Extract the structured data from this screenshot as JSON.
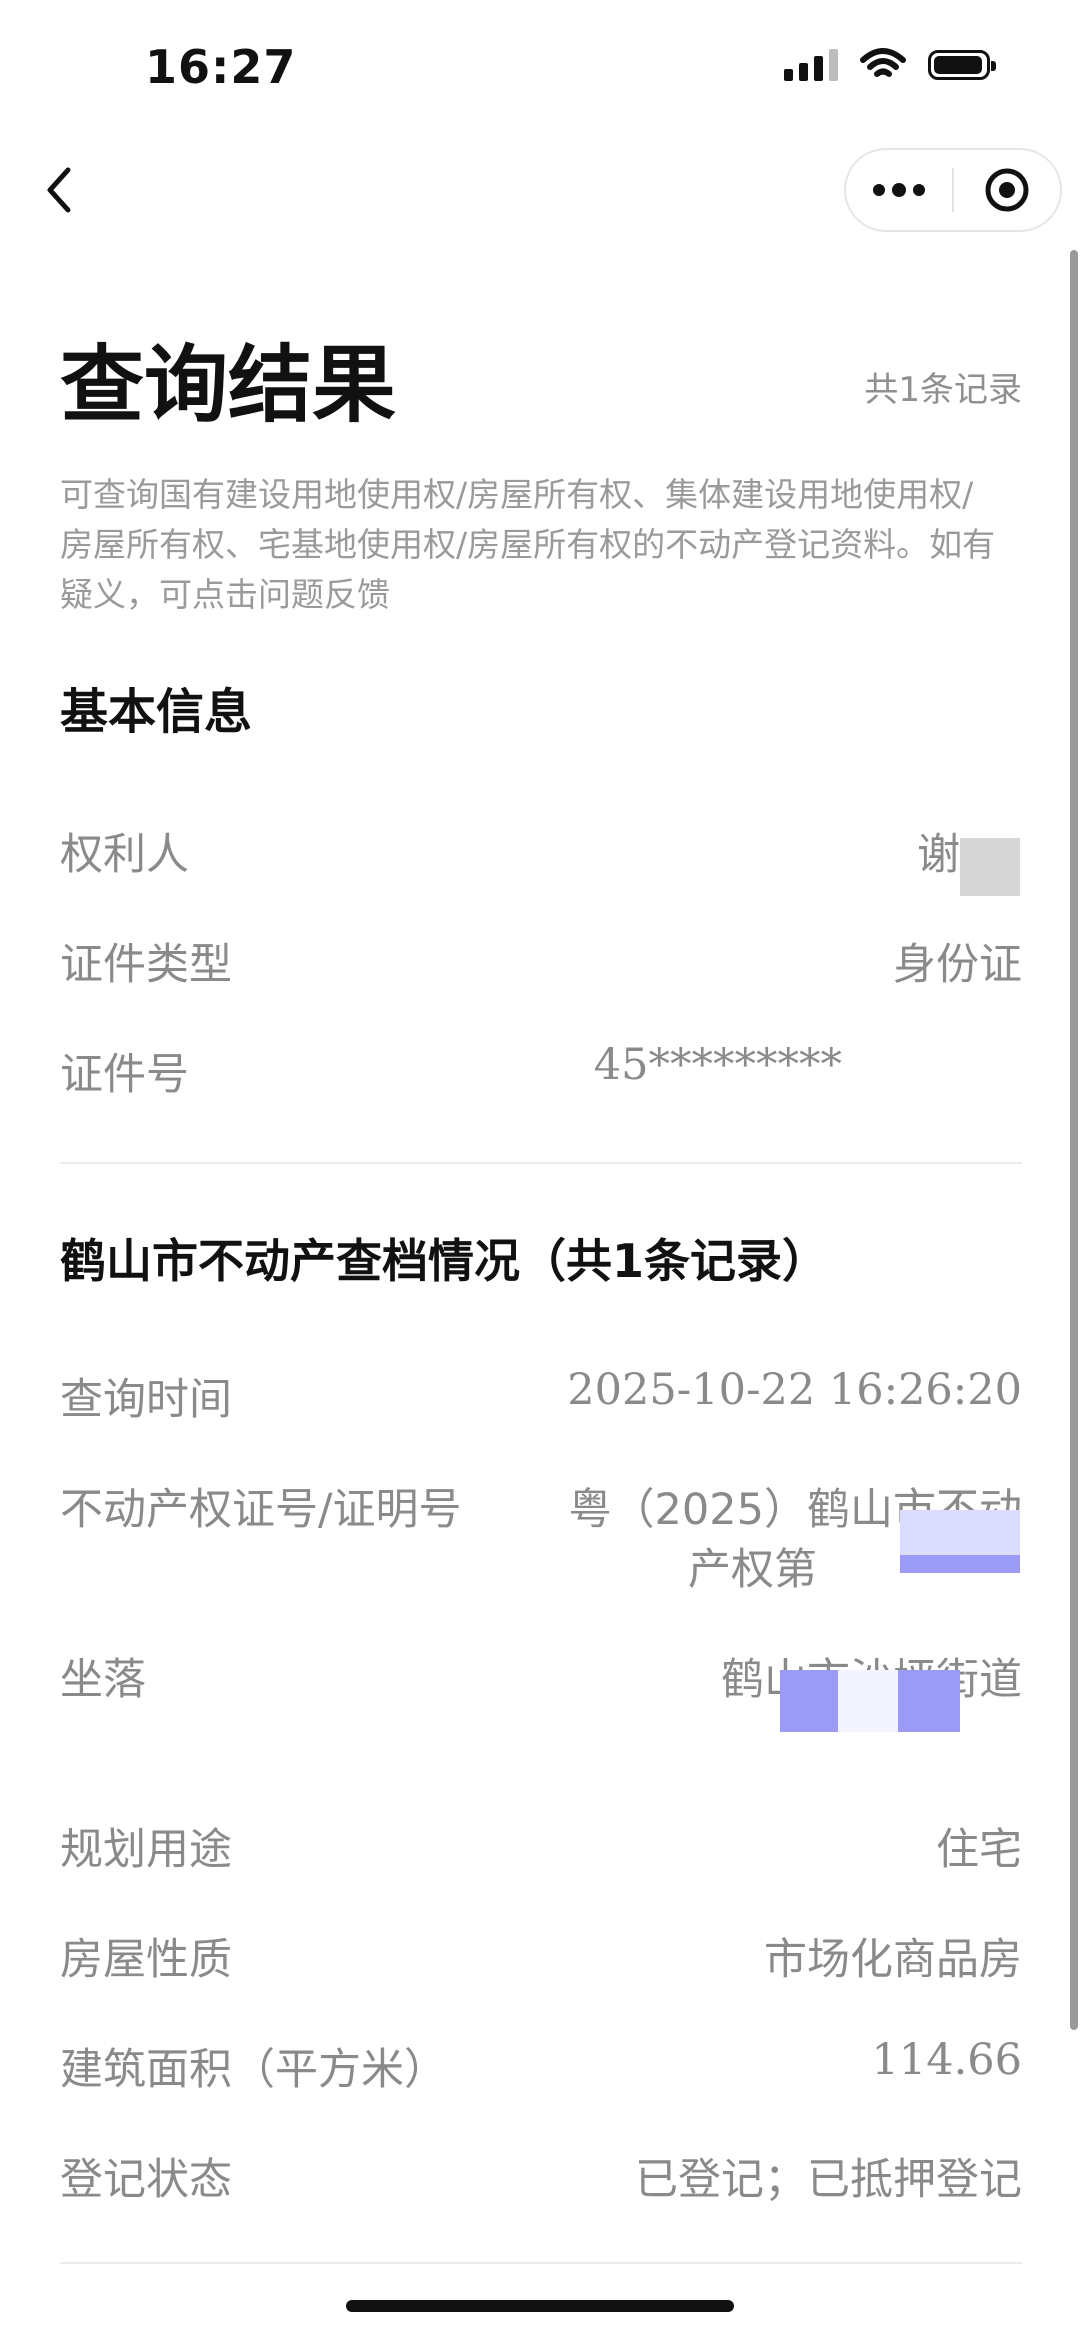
{
  "status_bar": {
    "time": "16:27"
  },
  "nav": {
    "back_icon": "chevron-left-icon",
    "more_icon": "more-dots-icon",
    "close_icon": "target-icon"
  },
  "page": {
    "title": "查询结果",
    "record_count": "共1条记录",
    "description": "可查询国有建设用地使用权/房屋所有权、集体建设用地使用权/房屋所有权、宅基地使用权/房屋所有权的不动产登记资料。如有疑义，可点击问题反馈"
  },
  "basic_info": {
    "title": "基本信息",
    "rows": [
      {
        "label": "权利人",
        "value": "谢"
      },
      {
        "label": "证件类型",
        "value": "身份证"
      },
      {
        "label": "证件号",
        "value": "45*********"
      }
    ]
  },
  "archive": {
    "title": "鹤山市不动产查档情况（共1条记录）",
    "query_time": {
      "label": "查询时间",
      "value": "2025-10-22 16:26:20"
    },
    "cert_no": {
      "label": "不动产权证号/证明号",
      "value_line1": "粤（2025）鹤山市不动",
      "value_line2": "产权第"
    },
    "location": {
      "label": "坐落",
      "value": "鹤山市沙坪街道"
    },
    "usage": {
      "label": "规划用途",
      "value": "住宅"
    },
    "nature": {
      "label": "房屋性质",
      "value": "市场化商品房"
    },
    "area": {
      "label": "建筑面积（平方米）",
      "value": "114.66"
    },
    "status": {
      "label": "登记状态",
      "value": "已登记；已抵押登记"
    }
  },
  "colors": {
    "muted_text": "#8a8a8a",
    "redaction_purple": "#9b9bf5",
    "redaction_gray": "#d6d6d6"
  }
}
